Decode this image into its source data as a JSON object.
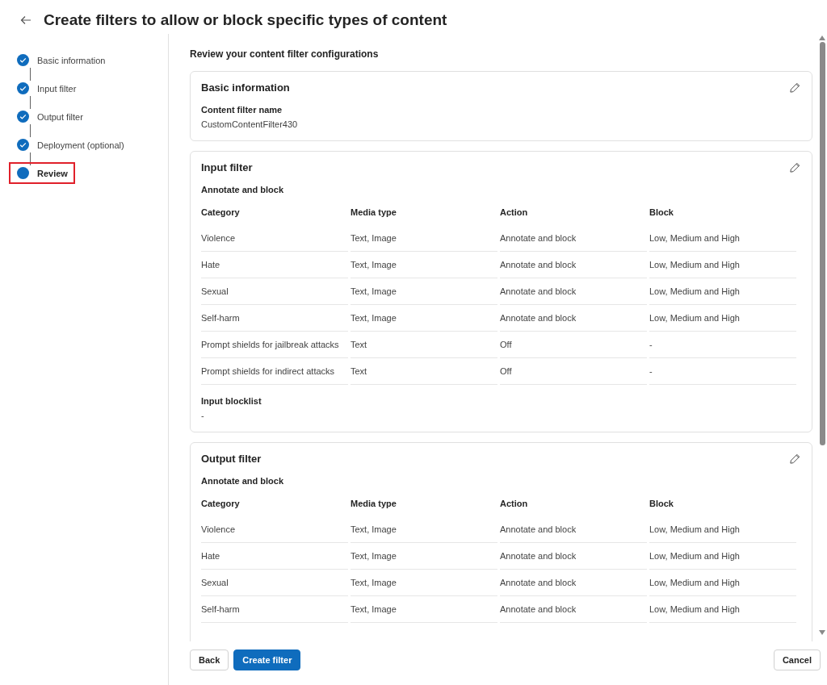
{
  "header": {
    "title": "Create filters to allow or block specific types of content"
  },
  "steps": [
    {
      "label": "Basic information",
      "completed": true,
      "selected": false,
      "highlighted": false
    },
    {
      "label": "Input filter",
      "completed": true,
      "selected": false,
      "highlighted": false
    },
    {
      "label": "Output filter",
      "completed": true,
      "selected": false,
      "highlighted": false
    },
    {
      "label": "Deployment (optional)",
      "completed": true,
      "selected": false,
      "highlighted": false
    },
    {
      "label": "Review",
      "completed": false,
      "selected": true,
      "highlighted": true
    }
  ],
  "review": {
    "heading": "Review your content filter configurations",
    "sections": [
      {
        "kind": "fields",
        "title": "Basic information",
        "fields": [
          {
            "label": "Content filter name",
            "value": "CustomContentFilter430"
          }
        ]
      },
      {
        "kind": "table",
        "title": "Input filter",
        "subtitle": "Annotate and block",
        "columns": [
          "Category",
          "Media type",
          "Action",
          "Block"
        ],
        "rows": [
          [
            "Violence",
            "Text, Image",
            "Annotate and block",
            "Low, Medium and High"
          ],
          [
            "Hate",
            "Text, Image",
            "Annotate and block",
            "Low, Medium and High"
          ],
          [
            "Sexual",
            "Text, Image",
            "Annotate and block",
            "Low, Medium and High"
          ],
          [
            "Self-harm",
            "Text, Image",
            "Annotate and block",
            "Low, Medium and High"
          ],
          [
            "Prompt shields for jailbreak attacks",
            "Text",
            "Off",
            "-"
          ],
          [
            "Prompt shields for indirect attacks",
            "Text",
            "Off",
            "-"
          ]
        ],
        "fields": [
          {
            "label": "Input blocklist",
            "value": "-"
          }
        ]
      },
      {
        "kind": "table",
        "title": "Output filter",
        "subtitle": "Annotate and block",
        "columns": [
          "Category",
          "Media type",
          "Action",
          "Block"
        ],
        "rows": [
          [
            "Violence",
            "Text, Image",
            "Annotate and block",
            "Low, Medium and High"
          ],
          [
            "Hate",
            "Text, Image",
            "Annotate and block",
            "Low, Medium and High"
          ],
          [
            "Sexual",
            "Text, Image",
            "Annotate and block",
            "Low, Medium and High"
          ],
          [
            "Self-harm",
            "Text, Image",
            "Annotate and block",
            "Low, Medium and High"
          ]
        ]
      }
    ]
  },
  "footer": {
    "buttons": [
      {
        "label": "Back",
        "kind": "secondary"
      },
      {
        "label": "Create filter",
        "kind": "primary"
      },
      {
        "label": "Cancel",
        "kind": "secondary"
      }
    ]
  }
}
